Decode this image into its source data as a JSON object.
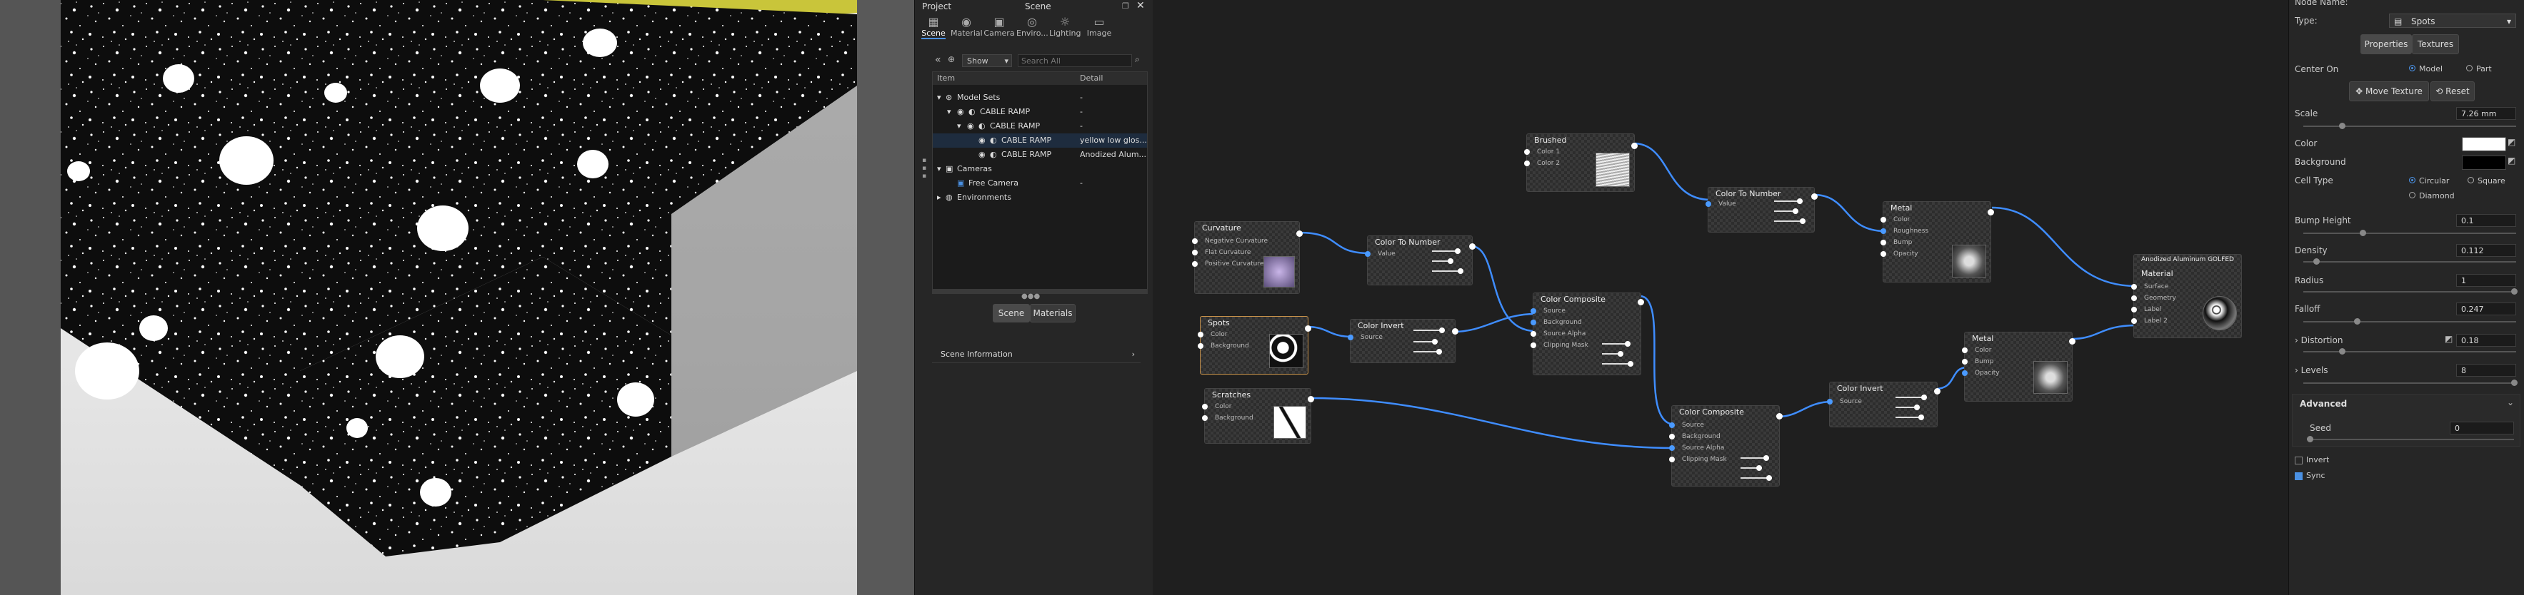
{
  "scene_panel": {
    "project_label": "Project",
    "scene_label": "Scene",
    "tabs": [
      {
        "label": "Scene",
        "icon": "scene-icon"
      },
      {
        "label": "Material",
        "icon": "material-icon"
      },
      {
        "label": "Camera",
        "icon": "camera-icon"
      },
      {
        "label": "Enviro...",
        "icon": "environment-icon"
      },
      {
        "label": "Lighting",
        "icon": "lighting-icon"
      },
      {
        "label": "Image",
        "icon": "image-icon"
      }
    ],
    "show_label": "Show",
    "search_placeholder": "Search All",
    "tree": {
      "col_item": "Item",
      "col_detail": "Detail",
      "rows": [
        {
          "label": "Model Sets",
          "detail": "-"
        },
        {
          "label": "CABLE RAMP",
          "detail": "-"
        },
        {
          "label": "CABLE RAMP",
          "detail": "-"
        },
        {
          "label": "CABLE RAMP",
          "detail": "yellow low glos..."
        },
        {
          "label": "CABLE RAMP",
          "detail": "Anodized Alum..."
        },
        {
          "label": "Cameras",
          "detail": ""
        },
        {
          "label": "Free Camera",
          "detail": "-"
        },
        {
          "label": "Environments",
          "detail": ""
        }
      ]
    },
    "bottom_tabs": [
      "Scene",
      "Materials"
    ],
    "scene_information": "Scene Information"
  },
  "graph": {
    "nodes": {
      "curvature": {
        "title": "Curvature",
        "ports": [
          "Negative Curvature",
          "Flat Curvature",
          "Positive Curvature"
        ]
      },
      "spots": {
        "title": "Spots",
        "ports": [
          "Color",
          "Background"
        ]
      },
      "scratches": {
        "title": "Scratches",
        "ports": [
          "Color",
          "Background"
        ]
      },
      "brushed": {
        "title": "Brushed",
        "ports": [
          "Color 1",
          "Color 2"
        ]
      },
      "ctn1": {
        "title": "Color To Number",
        "ports": [
          "Value"
        ]
      },
      "cinv1": {
        "title": "Color Invert",
        "ports": [
          "Source"
        ]
      },
      "ccomp1": {
        "title": "Color Composite",
        "ports": [
          "Source",
          "Background",
          "Source Alpha",
          "Clipping Mask"
        ]
      },
      "ctn2": {
        "title": "Color To Number",
        "ports": [
          "Value"
        ]
      },
      "metal1": {
        "title": "Metal",
        "ports": [
          "Color",
          "Roughness",
          "Bump",
          "Opacity"
        ]
      },
      "ccomp2": {
        "title": "Color Composite",
        "ports": [
          "Source",
          "Background",
          "Source Alpha",
          "Clipping Mask"
        ]
      },
      "cinv2": {
        "title": "Color Invert",
        "ports": [
          "Source"
        ]
      },
      "metal2": {
        "title": "Metal",
        "ports": [
          "Color",
          "Bump",
          "Opacity"
        ]
      },
      "material": {
        "title": "Anodized Aluminum GOLFED",
        "subtitle": "Material",
        "ports": [
          "Surface",
          "Geometry",
          "Label",
          "Label 2"
        ]
      }
    }
  },
  "properties": {
    "node_name_label": "Node Name:",
    "type_label": "Type:",
    "type_value": "Spots",
    "tab_properties": "Properties",
    "tab_textures": "Textures",
    "center_on_label": "Center On",
    "center_model": "Model",
    "center_part": "Part",
    "move_texture": "Move Texture",
    "reset": "Reset",
    "scale_label": "Scale",
    "scale_value": "7.26 mm",
    "scale_level": 0.18,
    "color_label": "Color",
    "color_value": "#ffffff",
    "background_label": "Background",
    "background_value": "#000000",
    "cell_type_label": "Cell Type",
    "cell_circular": "Circular",
    "cell_square": "Square",
    "cell_diamond": "Diamond",
    "bump_label": "Bump Height",
    "bump_value": "0.1",
    "bump_level": 0.28,
    "density_label": "Density",
    "density_value": "0.112",
    "density_level": 0.06,
    "radius_label": "Radius",
    "radius_value": "1",
    "radius_level": 0.99,
    "falloff_label": "Falloff",
    "falloff_value": "0.247",
    "falloff_level": 0.25,
    "distortion_label": "Distortion",
    "distortion_value": "0.18",
    "distortion_level": 0.18,
    "levels_label": "Levels",
    "levels_value": "8",
    "levels_level": 0.99,
    "advanced_label": "Advanced",
    "seed_label": "Seed",
    "seed_value": "0",
    "invert_label": "Invert",
    "sync_label": "Sync"
  }
}
